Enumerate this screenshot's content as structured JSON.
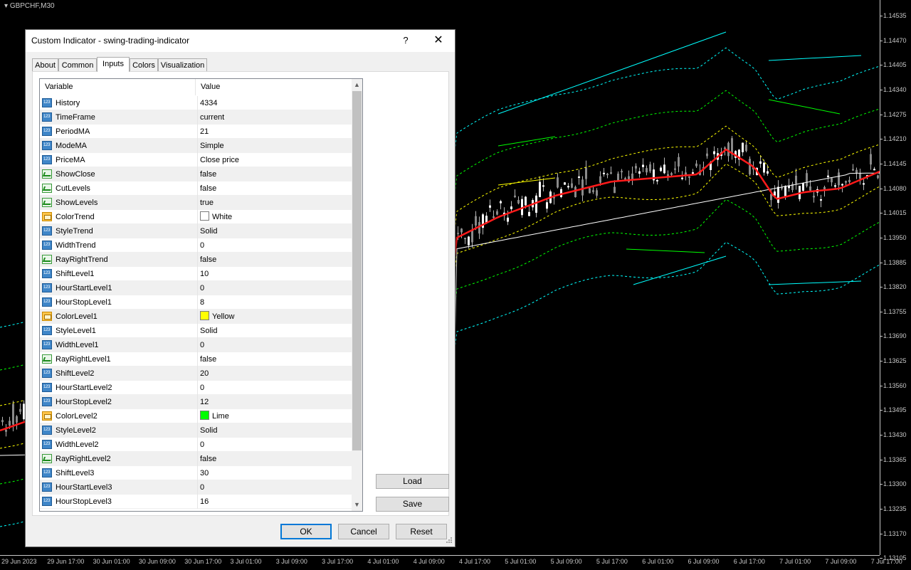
{
  "chart": {
    "symbol": "GBPCHF,M30",
    "price_labels": [
      "1.14535",
      "1.14470",
      "1.14405",
      "1.14340",
      "1.14275",
      "1.14210",
      "1.14145",
      "1.14080",
      "1.14015",
      "1.13950",
      "1.13885",
      "1.13820",
      "1.13755",
      "1.13690",
      "1.13625",
      "1.13560",
      "1.13495",
      "1.13430",
      "1.13365",
      "1.13300",
      "1.13235",
      "1.13170",
      "1.13105"
    ],
    "time_labels": [
      "29 Jun 2023",
      "29 Jun 17:00",
      "30 Jun 01:00",
      "30 Jun 09:00",
      "30 Jun 17:00",
      "3 Jul 01:00",
      "3 Jul 09:00",
      "3 Jul 17:00",
      "4 Jul 01:00",
      "4 Jul 09:00",
      "4 Jul 17:00",
      "5 Jul 01:00",
      "5 Jul 09:00",
      "5 Jul 17:00",
      "6 Jul 01:00",
      "6 Jul 09:00",
      "6 Jul 17:00",
      "7 Jul 01:00",
      "7 Jul 09:00",
      "7 Jul 17:00"
    ],
    "colors": {
      "background": "#000000",
      "ma": "#ff1a1a",
      "trend": "#ffffff",
      "level1": "#ffff00",
      "level2": "#00ff00",
      "level3": "#00ffff",
      "candle": "#b4b4b4"
    }
  },
  "dialog": {
    "title": "Custom Indicator - swing-trading-indicator",
    "help_label": "?",
    "close_label": "✕",
    "tabs": [
      {
        "label": "About"
      },
      {
        "label": "Common"
      },
      {
        "label": "Inputs"
      },
      {
        "label": "Colors"
      },
      {
        "label": "Visualization"
      }
    ],
    "active_tab": "Inputs",
    "grid": {
      "col_variable": "Variable",
      "col_value": "Value",
      "rows": [
        {
          "icon": "number-icon",
          "variable": "History",
          "value": "4334"
        },
        {
          "icon": "number-icon",
          "variable": "TimeFrame",
          "value": "current"
        },
        {
          "icon": "number-icon",
          "variable": "PeriodMA",
          "value": "21"
        },
        {
          "icon": "number-icon",
          "variable": "ModeMA",
          "value": "Simple"
        },
        {
          "icon": "number-icon",
          "variable": "PriceMA",
          "value": "Close price"
        },
        {
          "icon": "boolean-icon",
          "variable": "ShowClose",
          "value": "false"
        },
        {
          "icon": "boolean-icon",
          "variable": "CutLevels",
          "value": "false"
        },
        {
          "icon": "boolean-icon",
          "variable": "ShowLevels",
          "value": "true"
        },
        {
          "icon": "color-icon",
          "variable": "ColorTrend",
          "value": "White",
          "swatch": "#ffffff"
        },
        {
          "icon": "number-icon",
          "variable": "StyleTrend",
          "value": "Solid"
        },
        {
          "icon": "number-icon",
          "variable": "WidthTrend",
          "value": "0"
        },
        {
          "icon": "boolean-icon",
          "variable": "RayRightTrend",
          "value": "false"
        },
        {
          "icon": "number-icon",
          "variable": "ShiftLevel1",
          "value": "10"
        },
        {
          "icon": "number-icon",
          "variable": "HourStartLevel1",
          "value": "0"
        },
        {
          "icon": "number-icon",
          "variable": "HourStopLevel1",
          "value": "8"
        },
        {
          "icon": "color-icon",
          "variable": "ColorLevel1",
          "value": "Yellow",
          "swatch": "#ffff00"
        },
        {
          "icon": "number-icon",
          "variable": "StyleLevel1",
          "value": "Solid"
        },
        {
          "icon": "number-icon",
          "variable": "WidthLevel1",
          "value": "0"
        },
        {
          "icon": "boolean-icon",
          "variable": "RayRightLevel1",
          "value": "false"
        },
        {
          "icon": "number-icon",
          "variable": "ShiftLevel2",
          "value": "20"
        },
        {
          "icon": "number-icon",
          "variable": "HourStartLevel2",
          "value": "0"
        },
        {
          "icon": "number-icon",
          "variable": "HourStopLevel2",
          "value": "12"
        },
        {
          "icon": "color-icon",
          "variable": "ColorLevel2",
          "value": "Lime",
          "swatch": "#00ff00"
        },
        {
          "icon": "number-icon",
          "variable": "StyleLevel2",
          "value": "Solid"
        },
        {
          "icon": "number-icon",
          "variable": "WidthLevel2",
          "value": "0"
        },
        {
          "icon": "boolean-icon",
          "variable": "RayRightLevel2",
          "value": "false"
        },
        {
          "icon": "number-icon",
          "variable": "ShiftLevel3",
          "value": "30"
        },
        {
          "icon": "number-icon",
          "variable": "HourStartLevel3",
          "value": "0"
        },
        {
          "icon": "number-icon",
          "variable": "HourStopLevel3",
          "value": "16"
        }
      ]
    },
    "buttons": {
      "load": "Load",
      "save": "Save",
      "ok": "OK",
      "cancel": "Cancel",
      "reset": "Reset"
    }
  }
}
